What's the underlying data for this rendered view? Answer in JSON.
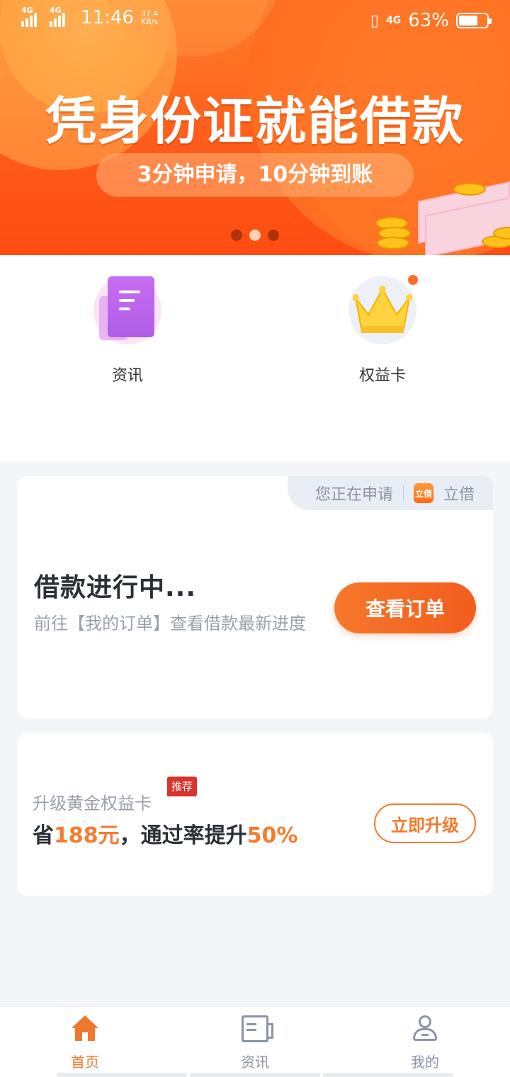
{
  "status_bar": {
    "network_1": "4G",
    "network_2": "4G",
    "time": "11:46",
    "speed_value": "37.4",
    "speed_unit": "KB/s",
    "network_right": "4G",
    "battery": "63%"
  },
  "banner": {
    "title": "凭身份证就能借款",
    "subtitle": "3分钟申请，10分钟到账",
    "slide_count": 3,
    "active_slide": 2
  },
  "quick_entries": [
    {
      "label": "资讯",
      "icon": "news-doc-icon"
    },
    {
      "label": "权益卡",
      "icon": "crown-icon"
    }
  ],
  "loan_card": {
    "applying_label": "您正在申请",
    "app_logo_text": "立借",
    "app_name": "立借",
    "title": "借款进行中...",
    "subtitle": "前往【我的订单】查看借款最新进度",
    "button": "查看订单"
  },
  "upgrade_card": {
    "title": "升级黄金权益卡",
    "badge": "推荐",
    "desc_prefix": "省",
    "save_amount": "188元",
    "desc_mid": "，通过率提升",
    "rate": "50%",
    "button": "立即升级"
  },
  "bottom_nav": {
    "items": [
      {
        "label": "首页",
        "icon": "home-icon",
        "active": true
      },
      {
        "label": "资讯",
        "icon": "news-icon",
        "active": false
      },
      {
        "label": "我的",
        "icon": "profile-icon",
        "active": false
      }
    ]
  },
  "colors": {
    "accent": "#f0782e",
    "banner": "#ff5a1a",
    "highlight": "#f77b2e",
    "badge": "#d9332b"
  }
}
